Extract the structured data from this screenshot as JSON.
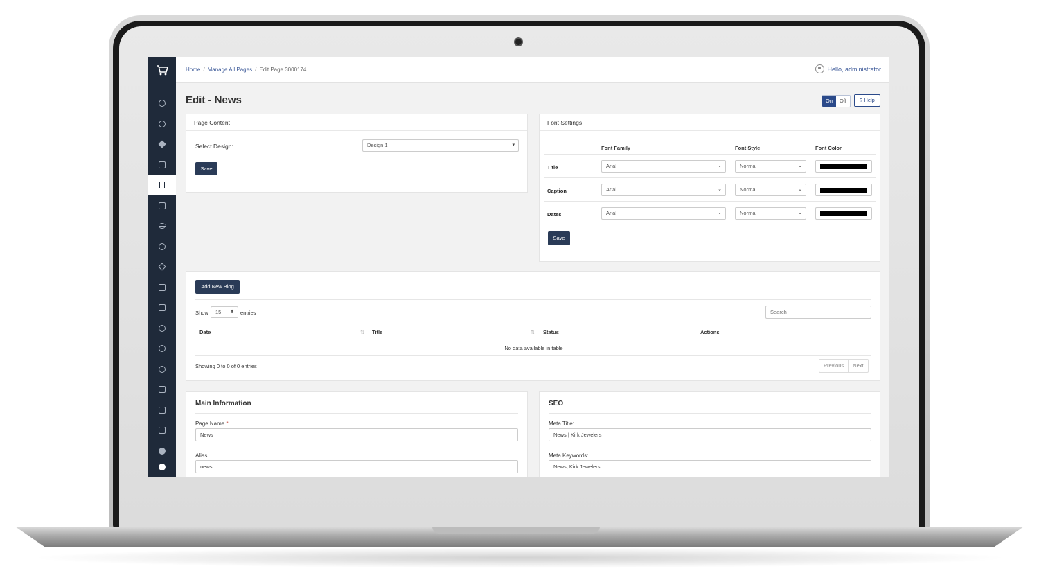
{
  "breadcrumb": {
    "home": "Home",
    "manage": "Manage All Pages",
    "current": "Edit Page 3000174"
  },
  "user": {
    "greeting": "Hello, administrator"
  },
  "page": {
    "title": "Edit - News"
  },
  "toggle": {
    "on": "On",
    "off": "Off"
  },
  "help": {
    "label": "? Help"
  },
  "page_content": {
    "header": "Page Content",
    "select_design_label": "Select Design:",
    "design_value": "Design 1",
    "save_label": "Save"
  },
  "font_settings": {
    "header": "Font Settings",
    "columns": {
      "family": "Font Family",
      "style": "Font Style",
      "color": "Font Color"
    },
    "rows": [
      {
        "label": "Title",
        "family": "Arial",
        "style": "Normal",
        "color": "#000000"
      },
      {
        "label": "Caption",
        "family": "Arial",
        "style": "Normal",
        "color": "#000000"
      },
      {
        "label": "Dates",
        "family": "Arial",
        "style": "Normal",
        "color": "#000000"
      }
    ],
    "save_label": "Save"
  },
  "blog": {
    "add_label": "Add New Blog",
    "show_label": "Show",
    "entries_value": "15",
    "entries_label": "entries",
    "search_placeholder": "Search",
    "columns": {
      "date": "Date",
      "title": "Title",
      "status": "Status",
      "actions": "Actions"
    },
    "empty": "No data available in table",
    "info": "Showing 0 to 0 of 0 entries",
    "prev": "Previous",
    "next": "Next"
  },
  "main_info": {
    "title": "Main Information",
    "page_name_label": "Page Name",
    "required_mark": "*",
    "page_name_value": "News",
    "alias_label": "Alias",
    "alias_value": "news"
  },
  "seo": {
    "title": "SEO",
    "meta_title_label": "Meta Title:",
    "meta_title_value": "News | Kirk Jewelers",
    "meta_keywords_label": "Meta Keywords:",
    "meta_keywords_value": "News, Kirk Jewelers"
  },
  "colors": {
    "sidebar": "#1f2a3a",
    "accent": "#2b4a8a",
    "button": "#2a3b57"
  }
}
